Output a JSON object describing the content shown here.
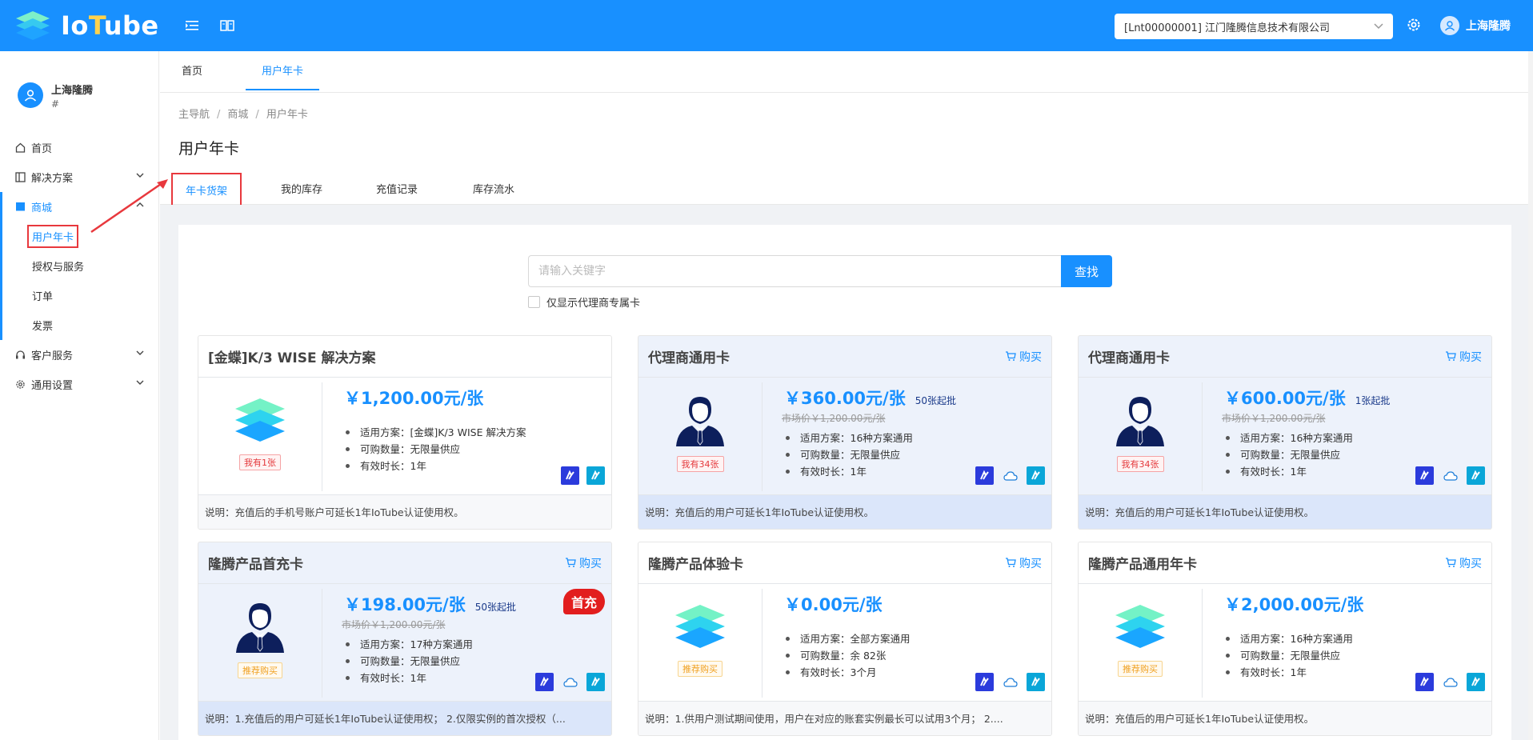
{
  "header": {
    "logo_prefix": "Io",
    "logo_highlight": "T",
    "logo_suffix": "ube",
    "company": "[Lnt00000001] 江门隆腾信息技术有限公司",
    "username": "上海隆腾"
  },
  "sidebar": {
    "user_name": "上海隆腾",
    "user_sub": "#",
    "items": [
      {
        "label": "首页",
        "icon": "home-icon"
      },
      {
        "label": "解决方案",
        "icon": "solution-icon"
      },
      {
        "label": "商城",
        "icon": "shop-icon"
      },
      {
        "label": "客户服务",
        "icon": "headset-icon"
      },
      {
        "label": "通用设置",
        "icon": "gear-icon"
      }
    ],
    "shop_sub": [
      "用户年卡",
      "授权与服务",
      "订单",
      "发票"
    ]
  },
  "top_tabs": [
    "首页",
    "用户年卡"
  ],
  "breadcrumb": [
    "主导航",
    "商城",
    "用户年卡"
  ],
  "page_title": "用户年卡",
  "sub_tabs": [
    "年卡货架",
    "我的库存",
    "充值记录",
    "库存流水"
  ],
  "search": {
    "placeholder": "请输入关键字",
    "button": "查找",
    "checkbox_label": "仅显示代理商专属卡"
  },
  "buy_label": "购买",
  "cards": [
    {
      "title": "[金蝶]K/3 WISE 解决方案",
      "price": "￥1,200.00元/张",
      "min": "",
      "market": "",
      "tag": "我有1张",
      "features": [
        "适用方案：[金蝶]K/3 WISE 解决方案",
        "可购数量：无限量供应",
        "有效时长：1年"
      ],
      "note": "说明：充值后的手机号账户可延长1年IoTube认证使用权。"
    },
    {
      "title": "代理商通用卡",
      "price": "￥360.00元/张",
      "min": "50张起批",
      "market": "市场价￥1,200.00元/张",
      "tag": "我有34张",
      "features": [
        "适用方案：16种方案通用",
        "可购数量：无限量供应",
        "有效时长：1年"
      ],
      "note": "说明：充值后的用户可延长1年IoTube认证使用权。"
    },
    {
      "title": "代理商通用卡",
      "price": "￥600.00元/张",
      "min": "1张起批",
      "market": "市场价￥1,200.00元/张",
      "tag": "我有34张",
      "features": [
        "适用方案：16种方案通用",
        "可购数量：无限量供应",
        "有效时长：1年"
      ],
      "note": "说明：充值后的用户可延长1年IoTube认证使用权。"
    },
    {
      "title": "隆腾产品首充卡",
      "price": "￥198.00元/张",
      "min": "50张起批",
      "market": "市场价￥1,200.00元/张",
      "tag": "推荐购买",
      "ribbon": "首充",
      "features": [
        "适用方案：17种方案通用",
        "可购数量：无限量供应",
        "有效时长：1年"
      ],
      "note": "说明：1.充值后的用户可延长1年IoTube认证使用权； 2.仅限实例的首次授权（..."
    },
    {
      "title": "隆腾产品体验卡",
      "price": "￥0.00元/张",
      "min": "",
      "market": "",
      "tag": "推荐购买",
      "features": [
        "适用方案：全部方案通用",
        "可购数量：余 82张",
        "有效时长：3个月"
      ],
      "note": "说明：1.供用户测试期间使用，用户在对应的账套实例最长可以试用3个月； 2...."
    },
    {
      "title": "隆腾产品通用年卡",
      "price": "￥2,000.00元/张",
      "min": "",
      "market": "",
      "tag": "推荐购买",
      "features": [
        "适用方案：16种方案通用",
        "可购数量：无限量供应",
        "有效时长：1年"
      ],
      "note": "说明：充值后的用户可延长1年IoTube认证使用权。"
    }
  ],
  "colors": {
    "primary": "#1890ff",
    "highlight_card": "#edf2fb",
    "annotation_red": "#e8383d"
  }
}
